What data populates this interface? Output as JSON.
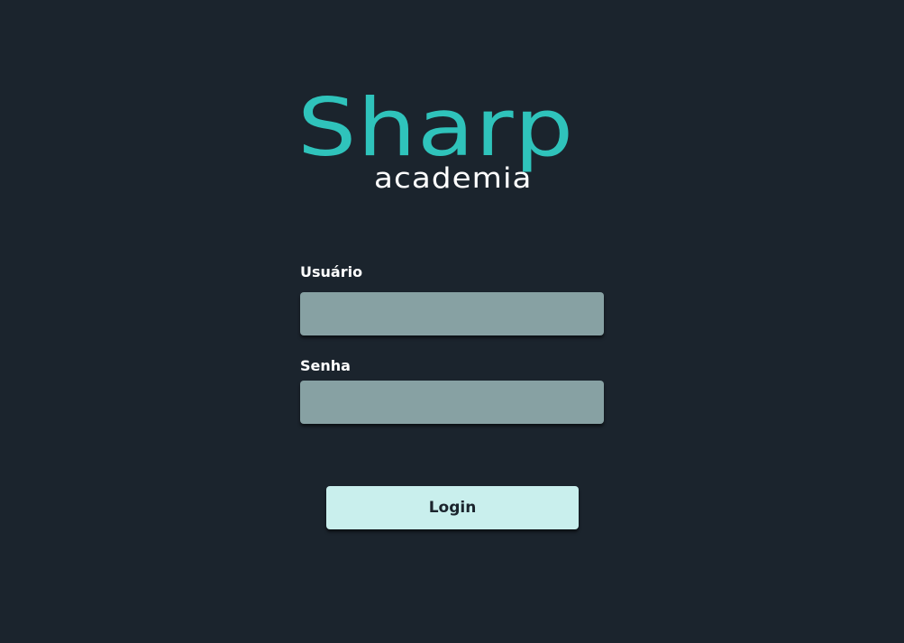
{
  "brand": {
    "name": "Sharp",
    "subtitle": "academia"
  },
  "form": {
    "username_label": "Usuário",
    "username_value": "",
    "password_label": "Senha",
    "password_value": "",
    "login_label": "Login"
  },
  "colors": {
    "background": "#1b242d",
    "brand_accent": "#2fc3bb",
    "subtitle_text": "#ffffff",
    "input_fill": "#87a1a3",
    "button_fill": "#c9efed"
  }
}
